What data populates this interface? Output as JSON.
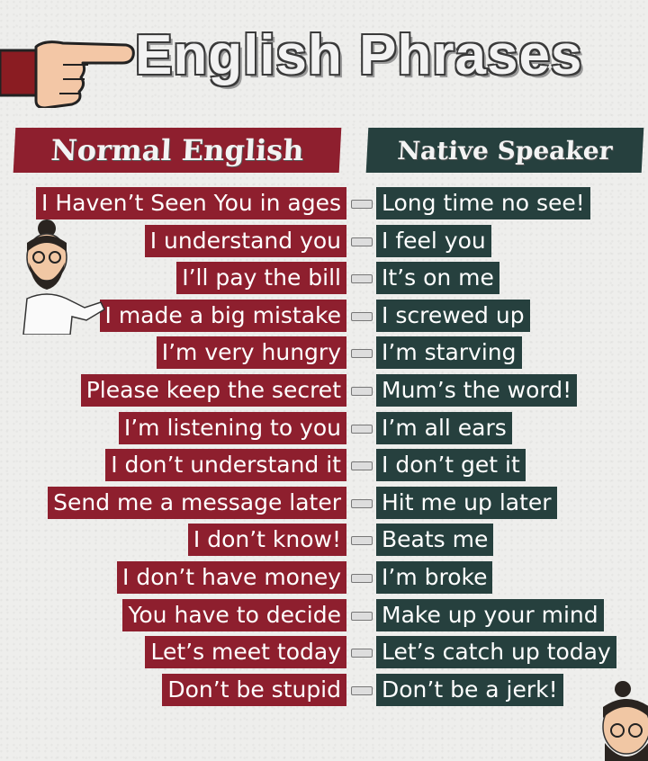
{
  "title": "English Phrases",
  "headers": {
    "left": "Normal English",
    "right": "Native Speaker"
  },
  "colors": {
    "normal_bg": "#8e1f2e",
    "native_bg": "#26403e",
    "title_fill": "#f2f2f2"
  },
  "icons": [
    "pointing-hand-icon",
    "bearded-man-avatar-icon"
  ],
  "phrases": [
    {
      "normal": "I Haven’t Seen You in ages",
      "native": "Long time no see!"
    },
    {
      "normal": "I understand you",
      "native": "I feel you"
    },
    {
      "normal": "I’ll pay the bill",
      "native": "It’s on me"
    },
    {
      "normal": "I made a big mistake",
      "native": "I screwed up"
    },
    {
      "normal": "I’m very hungry",
      "native": "I’m starving"
    },
    {
      "normal": "Please keep the secret",
      "native": "Mum’s the word!"
    },
    {
      "normal": "I’m listening to you",
      "native": "I’m all ears"
    },
    {
      "normal": "I don’t understand it",
      "native": "I don’t get it"
    },
    {
      "normal": "Send me a message later",
      "native": "Hit me up later"
    },
    {
      "normal": "I don’t know!",
      "native": "Beats me"
    },
    {
      "normal": "I don’t have money",
      "native": "I’m broke"
    },
    {
      "normal": "You have to decide",
      "native": "Make up your mind"
    },
    {
      "normal": "Let’s meet today",
      "native": "Let’s catch up today"
    },
    {
      "normal": "Don’t be stupid",
      "native": "Don’t be a jerk!"
    }
  ]
}
